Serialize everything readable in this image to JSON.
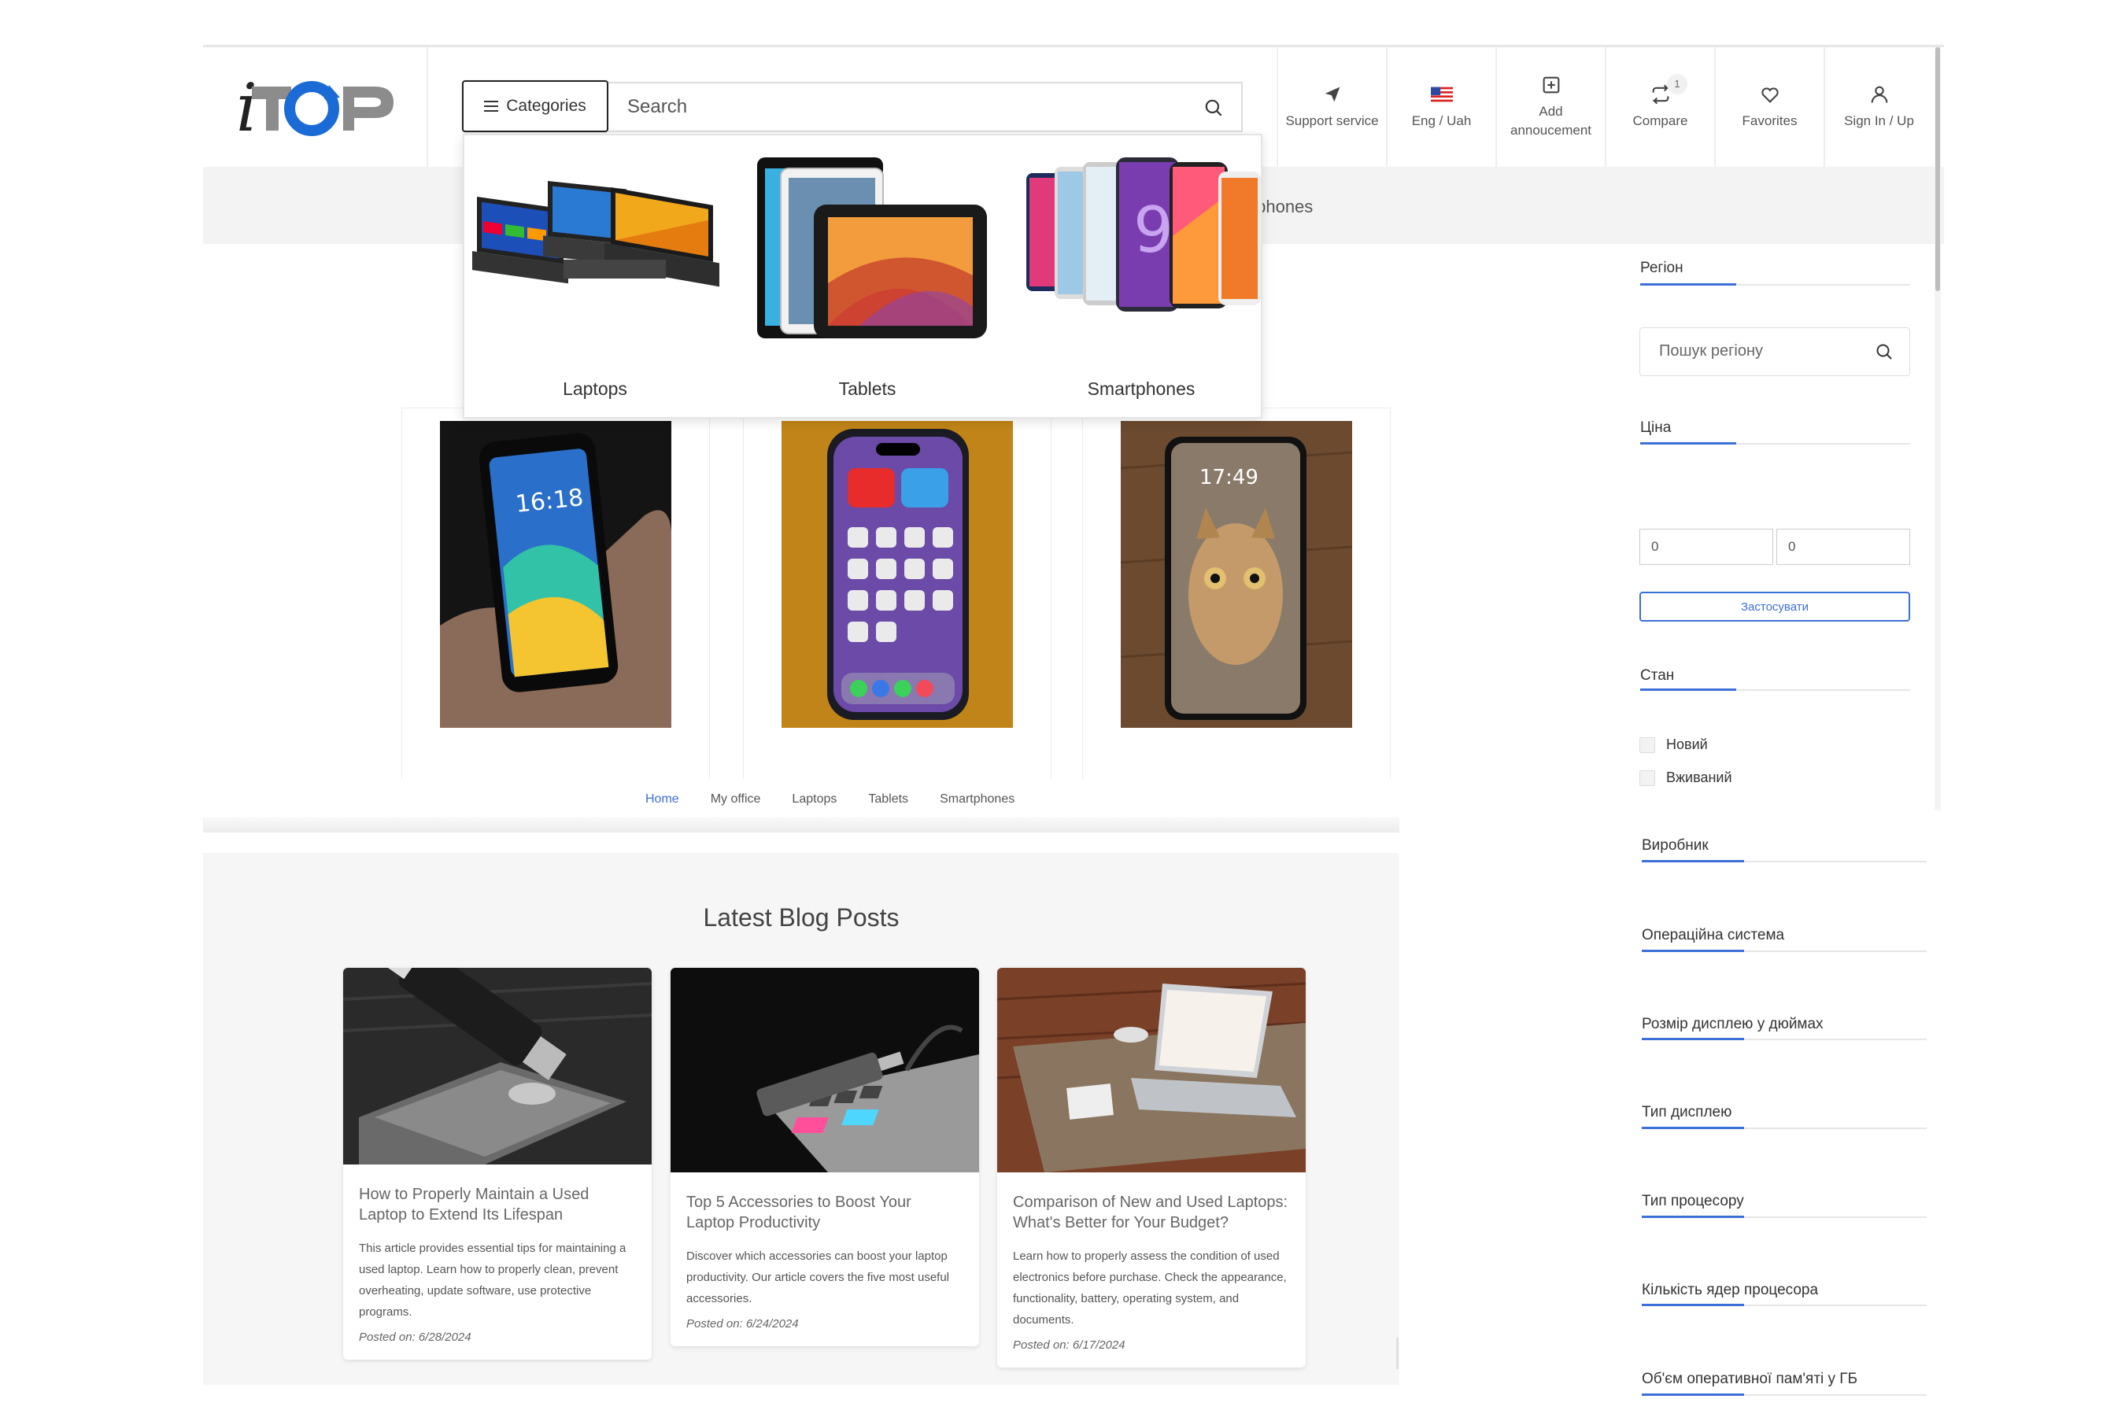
{
  "header": {
    "search_placeholder": "Search",
    "categories_label": "Categories",
    "nav": [
      {
        "label": "Support service",
        "icon": "paper-plane-icon"
      },
      {
        "label": "Eng / Uah",
        "icon": "us-flag-icon"
      },
      {
        "label": "Add annoucement",
        "icon": "plus-square-icon"
      },
      {
        "label": "Compare",
        "icon": "compare-arrows-icon",
        "badge": "1"
      },
      {
        "label": "Favorites",
        "icon": "heart-icon"
      },
      {
        "label": "Sign In / Up",
        "icon": "user-icon"
      }
    ]
  },
  "breadcrumb": {
    "visible_text": "tphones"
  },
  "dropdown": {
    "items": [
      {
        "label": "Laptops"
      },
      {
        "label": "Tablets"
      },
      {
        "label": "Smartphones"
      }
    ]
  },
  "tabs": {
    "items": [
      "Home",
      "My office",
      "Laptops",
      "Tablets",
      "Smartphones"
    ],
    "active": "Home"
  },
  "blog": {
    "title": "Latest Blog Posts",
    "posts": [
      {
        "title": "How to Properly Maintain a Used Laptop to Extend Its Lifespan",
        "excerpt": "This article provides essential tips for maintaining a used laptop. Learn how to properly clean, prevent overheating, update software, use protective programs.",
        "date": "Posted on: 6/28/2024"
      },
      {
        "title": "Top 5 Accessories to Boost Your Laptop Productivity",
        "excerpt": "Discover which accessories can boost your laptop productivity. Our article covers the five most useful accessories.",
        "date": "Posted on: 6/24/2024"
      },
      {
        "title": "Comparison of New and Used Laptops: What's Better for Your Budget?",
        "excerpt": "Learn how to properly assess the condition of used electronics before purchase. Check the appearance, functionality, battery, operating system, and documents.",
        "date": "Posted on: 6/17/2024"
      }
    ]
  },
  "sidebar": {
    "region_title": "Регіон",
    "region_placeholder": "Пошук регіону",
    "price_title": "Ціна",
    "price_min": "0",
    "price_max": "0",
    "apply_label": "Застосувати",
    "condition_title": "Стан",
    "condition_options": [
      "Новий",
      "Вживаний"
    ],
    "filters": [
      "Виробник",
      "Операційна система",
      "Розмір дисплею у дюймах",
      "Тип дисплею",
      "Тип процесору",
      "Кількість ядер процесора",
      "Об'єм оперативної пам'яті у ГБ"
    ]
  },
  "colors": {
    "accent": "#3d6fd8",
    "logo_blue": "#1a6bd6",
    "logo_gray": "#8c8c8c"
  }
}
